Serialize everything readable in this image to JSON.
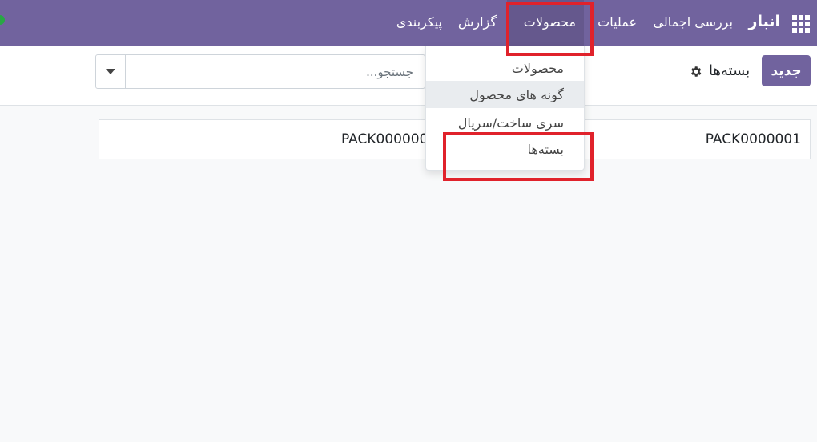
{
  "navbar": {
    "brand": "انبار",
    "menu": [
      "بررسی اجمالی",
      "عملیات",
      "محصولات",
      "گزارش",
      "پیکربندی"
    ],
    "active_menu": "محصولات",
    "accent_color": "#71639e",
    "apps_icon": "apps-grid-icon"
  },
  "control_panel": {
    "new_button": "جدید",
    "breadcrumb": "بسته‌ها",
    "gear_icon": "gear-icon",
    "search_placeholder": "جستجو..."
  },
  "dropdown": {
    "items": [
      "محصولات",
      "گونه های محصول",
      "سری ساخت/سریال",
      "بسته‌ها"
    ],
    "hovered_item": "گونه های محصول"
  },
  "kanban": {
    "records": [
      "PACK0000001",
      "PACK0000002"
    ]
  },
  "annotations": {
    "highlight_color": "#e0222b"
  }
}
